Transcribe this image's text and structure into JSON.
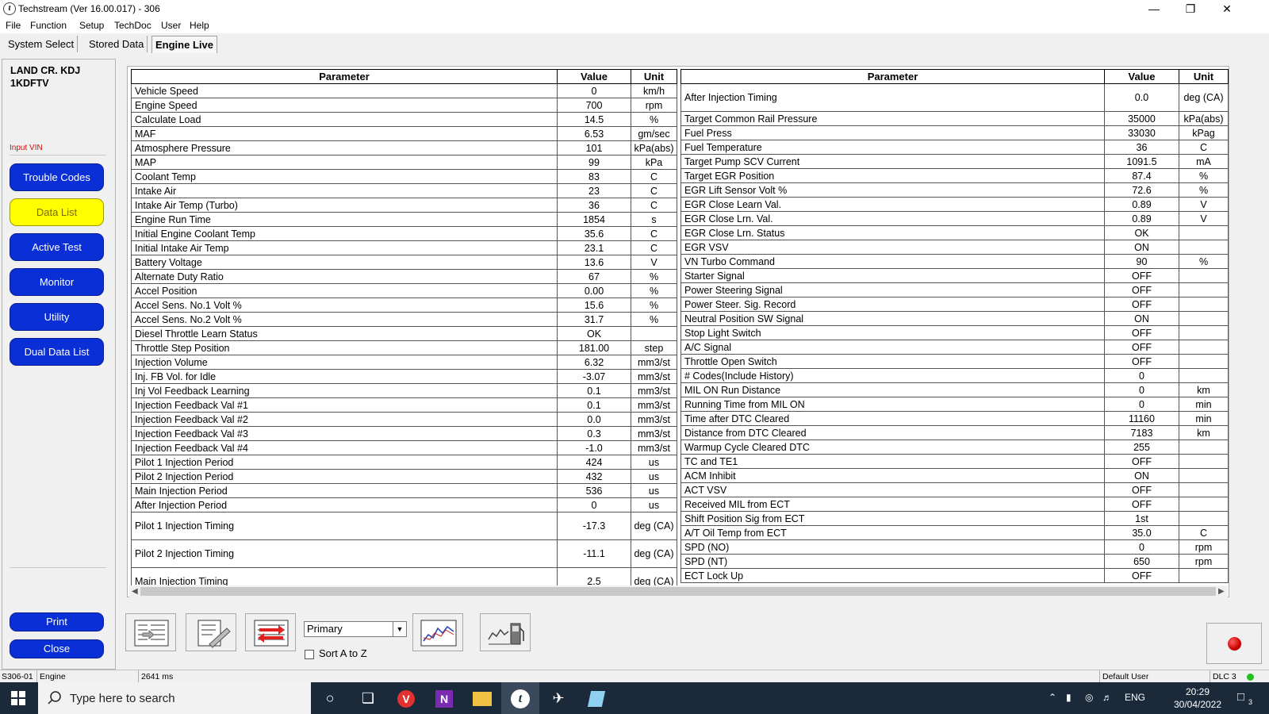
{
  "window": {
    "title": "Techstream (Ver 16.00.017) - 306",
    "minimize": "—",
    "restore": "❐",
    "close": "✕"
  },
  "menu": [
    "File",
    "Function",
    "Setup",
    "TechDoc",
    "User",
    "Help"
  ],
  "tabs": [
    "System Select",
    "Stored Data",
    "Engine Live"
  ],
  "sidebar": {
    "vehicle_line1": "LAND CR. KDJ",
    "vehicle_line2": "1KDFTV",
    "input_vin": "Input VIN",
    "buttons": [
      "Trouble Codes",
      "Data List",
      "Active Test",
      "Monitor",
      "Utility",
      "Dual Data List"
    ],
    "print": "Print",
    "close": "Close"
  },
  "table_headers": {
    "parameter": "Parameter",
    "value": "Value",
    "unit": "Unit"
  },
  "left_rows": [
    [
      "Vehicle Speed",
      "0",
      "km/h"
    ],
    [
      "Engine Speed",
      "700",
      "rpm"
    ],
    [
      "Calculate Load",
      "14.5",
      "%"
    ],
    [
      "MAF",
      "6.53",
      "gm/sec"
    ],
    [
      "Atmosphere Pressure",
      "101",
      "kPa(abs)"
    ],
    [
      "MAP",
      "99",
      "kPa"
    ],
    [
      "Coolant Temp",
      "83",
      "C"
    ],
    [
      "Intake Air",
      "23",
      "C"
    ],
    [
      "Intake Air Temp (Turbo)",
      "36",
      "C"
    ],
    [
      "Engine Run Time",
      "1854",
      "s"
    ],
    [
      "Initial Engine Coolant Temp",
      "35.6",
      "C"
    ],
    [
      "Initial Intake Air Temp",
      "23.1",
      "C"
    ],
    [
      "Battery Voltage",
      "13.6",
      "V"
    ],
    [
      "Alternate Duty Ratio",
      "67",
      "%"
    ],
    [
      "Accel Position",
      "0.00",
      "%"
    ],
    [
      "Accel Sens. No.1 Volt %",
      "15.6",
      "%"
    ],
    [
      "Accel Sens. No.2 Volt %",
      "31.7",
      "%"
    ],
    [
      "Diesel Throttle Learn Status",
      "OK",
      ""
    ],
    [
      "Throttle Step Position",
      "181.00",
      "step"
    ],
    [
      "Injection Volume",
      "6.32",
      "mm3/st"
    ],
    [
      "Inj. FB Vol. for Idle",
      "-3.07",
      "mm3/st"
    ],
    [
      "Inj Vol Feedback Learning",
      "0.1",
      "mm3/st"
    ],
    [
      "Injection Feedback Val #1",
      "0.1",
      "mm3/st"
    ],
    [
      "Injection Feedback Val #2",
      "0.0",
      "mm3/st"
    ],
    [
      "Injection Feedback Val #3",
      "0.3",
      "mm3/st"
    ],
    [
      "Injection Feedback Val #4",
      "-1.0",
      "mm3/st"
    ],
    [
      "Pilot 1 Injection Period",
      "424",
      "us"
    ],
    [
      "Pilot 2 Injection Period",
      "432",
      "us"
    ],
    [
      "Main Injection Period",
      "536",
      "us"
    ],
    [
      "After Injection Period",
      "0",
      "us"
    ],
    [
      "Pilot 1 Injection Timing",
      "-17.3",
      "deg (CA)"
    ],
    [
      "Pilot 2 Injection Timing",
      "-11.1",
      "deg (CA)"
    ],
    [
      "Main Injection Timing",
      "2.5",
      "deg (CA)"
    ]
  ],
  "right_rows": [
    [
      "After Injection Timing",
      "0.0",
      "deg (CA)"
    ],
    [
      "Target Common Rail Pressure",
      "35000",
      "kPa(abs)"
    ],
    [
      "Fuel Press",
      "33030",
      "kPag"
    ],
    [
      "Fuel Temperature",
      "36",
      "C"
    ],
    [
      "Target Pump SCV Current",
      "1091.5",
      "mA"
    ],
    [
      "Target EGR Position",
      "87.4",
      "%"
    ],
    [
      "EGR Lift Sensor Volt %",
      "72.6",
      "%"
    ],
    [
      "EGR Close Learn Val.",
      "0.89",
      "V"
    ],
    [
      "EGR Close Lrn. Val.",
      "0.89",
      "V"
    ],
    [
      "EGR Close Lrn. Status",
      "OK",
      ""
    ],
    [
      "EGR VSV",
      "ON",
      ""
    ],
    [
      "VN Turbo Command",
      "90",
      "%"
    ],
    [
      "Starter Signal",
      "OFF",
      ""
    ],
    [
      "Power Steering Signal",
      "OFF",
      ""
    ],
    [
      "Power Steer. Sig. Record",
      "OFF",
      ""
    ],
    [
      "Neutral Position SW Signal",
      "ON",
      ""
    ],
    [
      "Stop Light Switch",
      "OFF",
      ""
    ],
    [
      "A/C Signal",
      "OFF",
      ""
    ],
    [
      "Throttle Open Switch",
      "OFF",
      ""
    ],
    [
      "# Codes(Include History)",
      "0",
      ""
    ],
    [
      "MIL ON Run Distance",
      "0",
      "km"
    ],
    [
      "Running Time from MIL ON",
      "0",
      "min"
    ],
    [
      "Time after DTC Cleared",
      "11160",
      "min"
    ],
    [
      "Distance from DTC Cleared",
      "7183",
      "km"
    ],
    [
      "Warmup Cycle Cleared DTC",
      "255",
      ""
    ],
    [
      "TC and TE1",
      "OFF",
      ""
    ],
    [
      "ACM Inhibit",
      "ON",
      ""
    ],
    [
      "ACT VSV",
      "OFF",
      ""
    ],
    [
      "Received MIL from ECT",
      "OFF",
      ""
    ],
    [
      "Shift Position Sig from ECT",
      "1st",
      ""
    ],
    [
      "A/T Oil Temp from ECT",
      "35.0",
      "C"
    ],
    [
      "SPD (NO)",
      "0",
      "rpm"
    ],
    [
      "SPD (NT)",
      "650",
      "rpm"
    ],
    [
      "ECT Lock Up",
      "OFF",
      ""
    ]
  ],
  "toolbar": {
    "selection": "Primary",
    "sort_label": "Sort A to Z"
  },
  "status": {
    "code": "S306-01",
    "system": "Engine",
    "interval": "2641 ms",
    "user": "Default User",
    "dlc": "DLC 3"
  },
  "taskbar": {
    "search_placeholder": "Type here to search",
    "language": "ENG",
    "time": "20:29",
    "date": "30/04/2022",
    "notifications": "3"
  },
  "colors": {
    "nav_blue": "#0a2fd6",
    "nav_active": "#ffff00",
    "record_red": "#cc0000",
    "dlc_ok": "#20c020"
  }
}
